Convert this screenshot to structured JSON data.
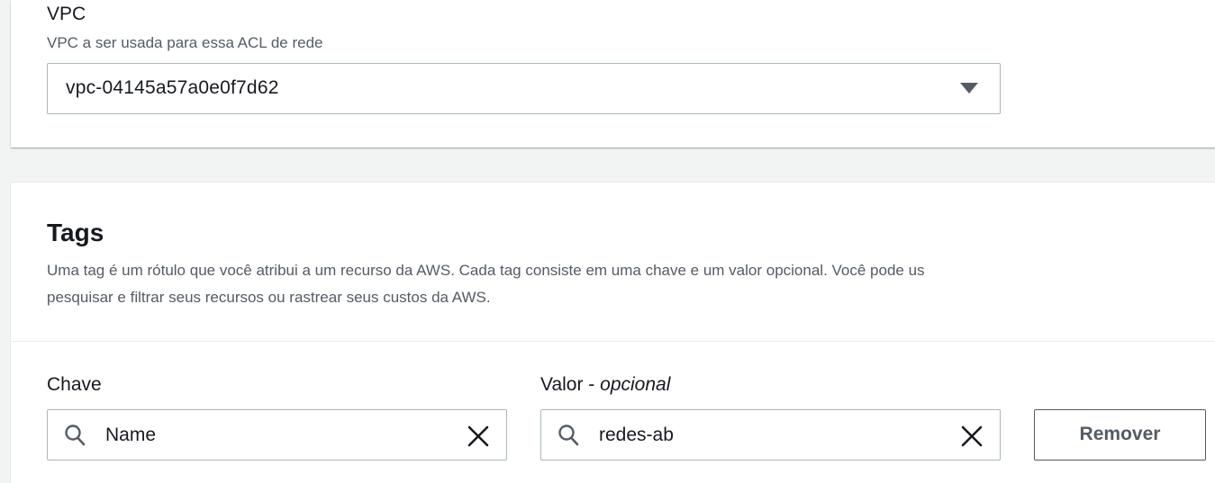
{
  "vpc": {
    "label": "VPC",
    "description": "VPC a ser usada para essa ACL de rede",
    "selected_value": "vpc-04145a57a0e0f7d62",
    "dropdown_icon": "caret-down-icon"
  },
  "tags": {
    "title": "Tags",
    "description_line1": "Uma tag é um rótulo que você atribui a um recurso da AWS. Cada tag consiste em uma chave e um valor opcional. Você pode us",
    "description_line2": "pesquisar e filtrar seus recursos ou rastrear seus custos da AWS.",
    "key_label": "Chave",
    "value_label": "Valor - ",
    "value_label_optional": "opcional",
    "rows": [
      {
        "key": "Name",
        "value": "redes-ab",
        "remove_label": "Remover"
      }
    ],
    "icons": {
      "search": "search-icon",
      "clear": "close-icon"
    }
  },
  "colors": {
    "background": "#f2f3f3",
    "panel": "#ffffff",
    "text": "#16191f",
    "secondary_text": "#545b64",
    "border": "#aab7b8"
  }
}
